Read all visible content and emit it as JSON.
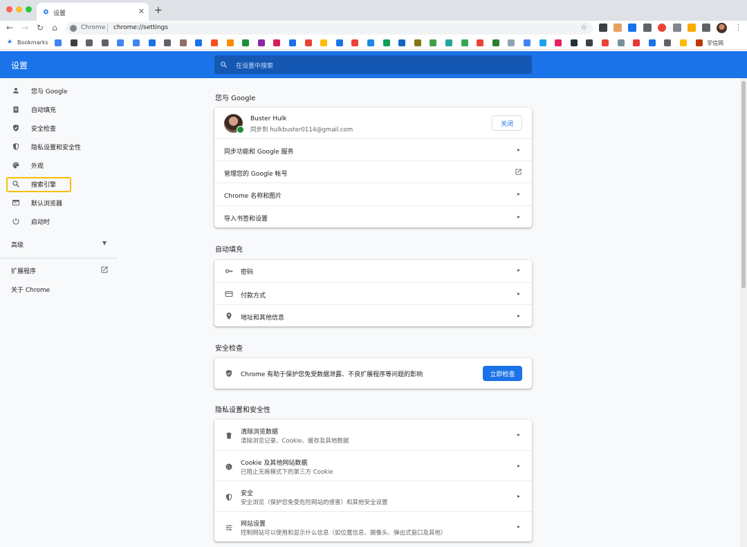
{
  "window": {
    "tab_title": "设置",
    "new_tab_symbol": "+",
    "omnibox_origin": "Chrome",
    "omnibox_url": "chrome://settings"
  },
  "bookmarks": {
    "label": "Bookmarks",
    "right_label": "学信网"
  },
  "header": {
    "title": "设置",
    "search_placeholder": "在设置中搜索"
  },
  "sidebar": {
    "items": [
      {
        "label": "您与 Google",
        "icon": "person-icon"
      },
      {
        "label": "自动填充",
        "icon": "clipboard-icon"
      },
      {
        "label": "安全检查",
        "icon": "shield-check-icon"
      },
      {
        "label": "隐私设置和安全性",
        "icon": "shield-icon"
      },
      {
        "label": "外观",
        "icon": "palette-icon"
      },
      {
        "label": "搜索引擎",
        "icon": "search-icon"
      },
      {
        "label": "默认浏览器",
        "icon": "browser-icon"
      },
      {
        "label": "启动时",
        "icon": "power-icon"
      }
    ],
    "advanced": "高级",
    "extensions": "扩展程序",
    "about": "关于 Chrome"
  },
  "sections": {
    "you_and_google": {
      "title": "您与 Google",
      "profile_name": "Buster Hulk",
      "profile_email": "同步到 hulkbuster0114@gmail.com",
      "turn_off_button": "关闭",
      "rows": [
        "同步功能和 Google 服务",
        "管理您的 Google 帐号",
        "Chrome 名称和图片",
        "导入书签和设置"
      ]
    },
    "autofill": {
      "title": "自动填充",
      "rows": [
        "密码",
        "付款方式",
        "地址和其他信息"
      ]
    },
    "safety_check": {
      "title": "安全检查",
      "text": "Chrome 有助于保护您免受数据泄露、不良扩展程序等问题的影响",
      "button": "立即检查"
    },
    "privacy": {
      "title": "隐私设置和安全性",
      "rows": [
        {
          "title": "清除浏览数据",
          "subtitle": "清除浏览记录、Cookie、缓存及其他数据"
        },
        {
          "title": "Cookie 及其他网站数据",
          "subtitle": "已阻止无痕模式下的第三方 Cookie"
        },
        {
          "title": "安全",
          "subtitle": "安全浏览（保护您免受危险网站的侵害）和其他安全设置"
        },
        {
          "title": "网站设置",
          "subtitle": "控制网站可以使用和显示什么信息（如位置信息、摄像头、弹出式窗口及其他）"
        }
      ]
    }
  },
  "colors": {
    "brand_blue": "#1a73e8",
    "highlight": "#fbbc04"
  }
}
